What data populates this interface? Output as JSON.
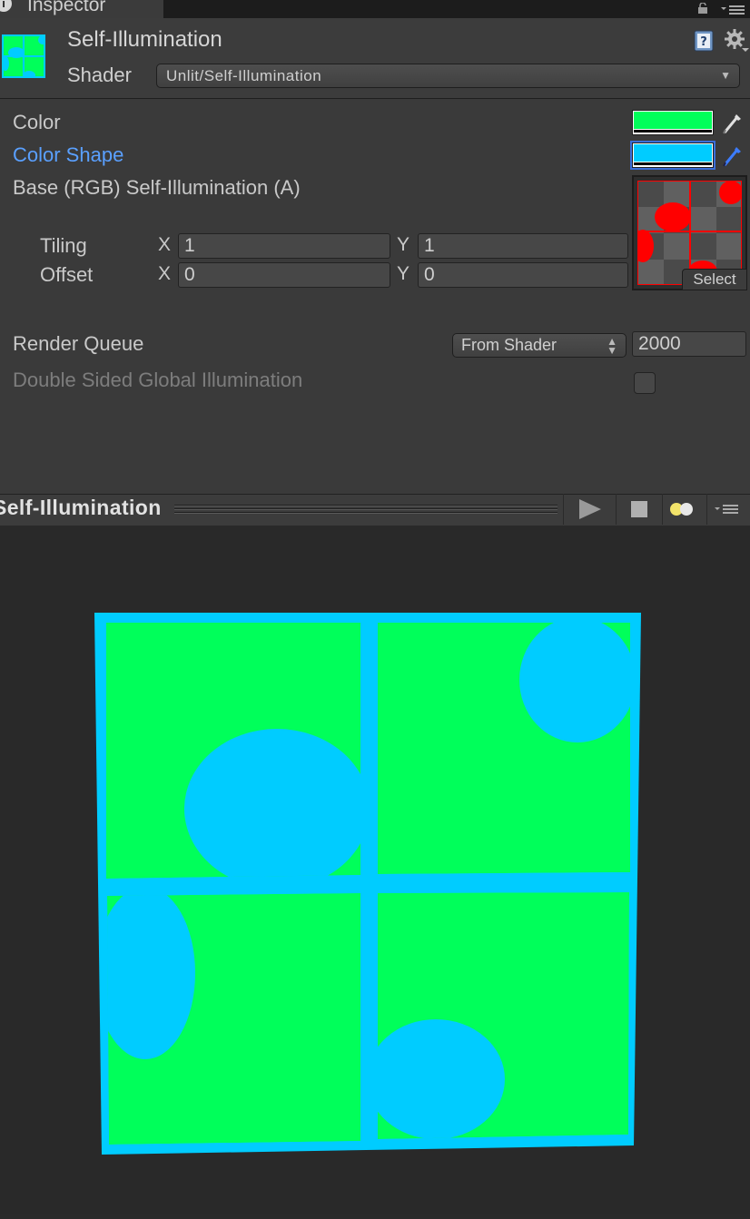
{
  "tab": {
    "label": "Inspector",
    "icon": "info-icon"
  },
  "header": {
    "material_name": "Self-Illumination",
    "shader_label": "Shader",
    "shader_value": "Unlit/Self-Illumination"
  },
  "properties": {
    "color_label": "Color",
    "color_value": "#00ff5a",
    "color_shape_label": "Color Shape",
    "color_shape_value": "#00ccff",
    "base_label": "Base (RGB) Self-Illumination (A)",
    "tiling_label": "Tiling",
    "offset_label": "Offset",
    "x_axis": "X",
    "y_axis": "Y",
    "tiling_x": "1",
    "tiling_y": "1",
    "offset_x": "0",
    "offset_y": "0",
    "select_label": "Select",
    "render_queue_label": "Render Queue",
    "render_queue_mode": "From Shader",
    "render_queue_value": "2000",
    "double_sided_gi_label": "Double Sided Global Illumination",
    "double_sided_gi_checked": false
  },
  "preview": {
    "title": "Self-Illumination"
  },
  "colors": {
    "green": "#00ff5a",
    "cyan": "#00ccff",
    "accent_blue": "#5aa0ff",
    "texture_red": "#ff0000"
  }
}
